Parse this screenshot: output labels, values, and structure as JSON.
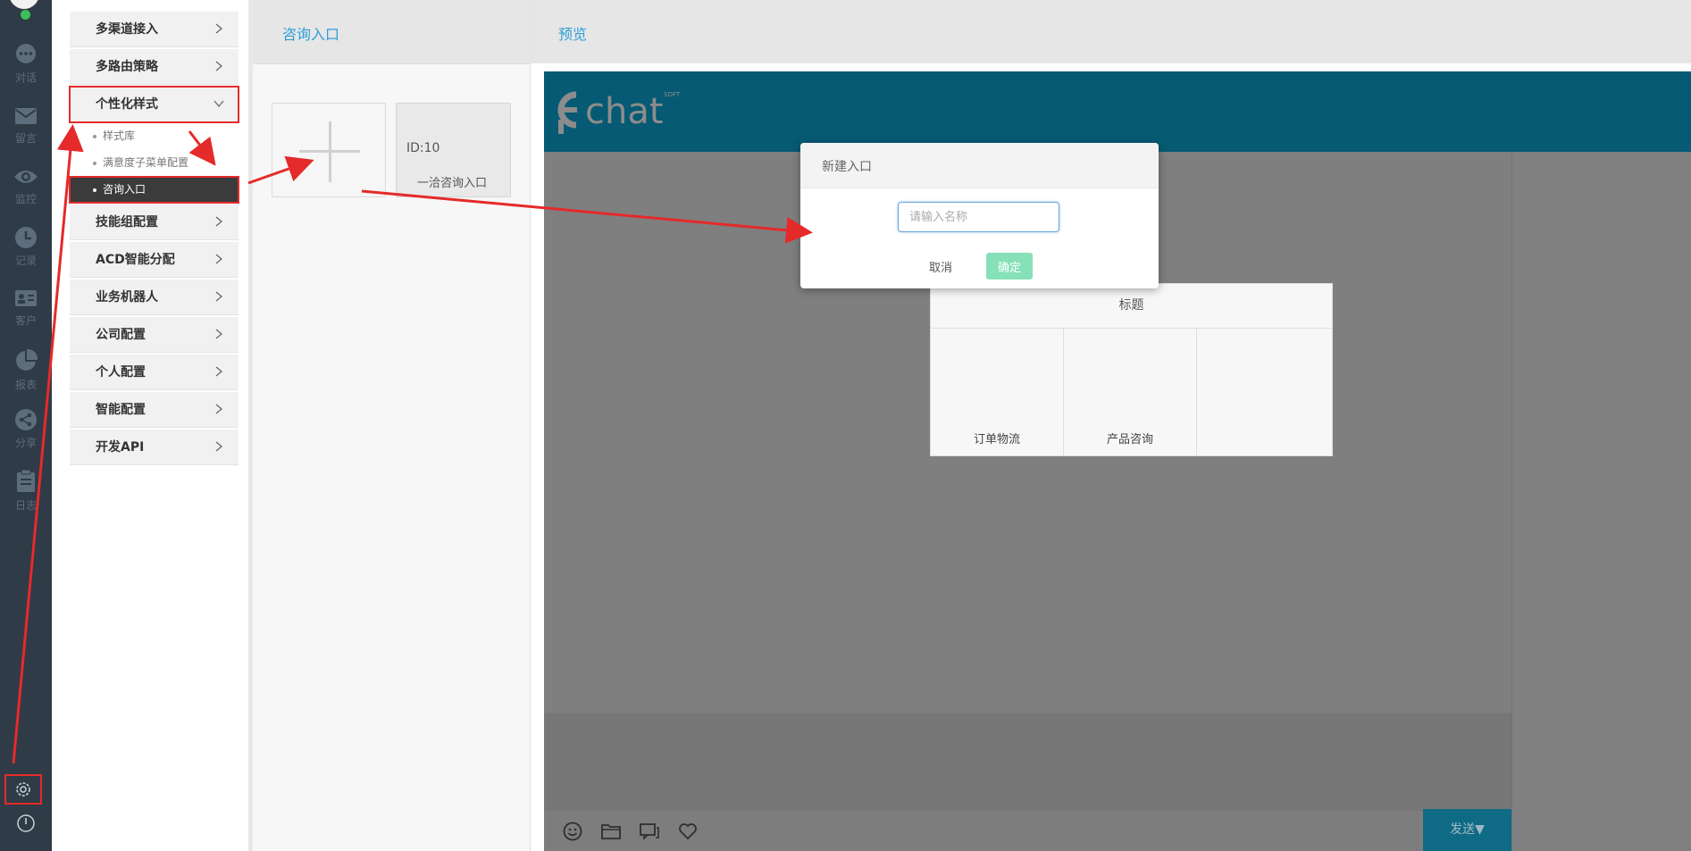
{
  "rail": {
    "items": [
      {
        "label": "对话",
        "icon": "chat-bubble-icon"
      },
      {
        "label": "留言",
        "icon": "envelope-icon"
      },
      {
        "label": "监控",
        "icon": "eye-icon"
      },
      {
        "label": "记录",
        "icon": "clock-icon"
      },
      {
        "label": "客户",
        "icon": "id-card-icon"
      },
      {
        "label": "报表",
        "icon": "pie-chart-icon"
      },
      {
        "label": "分享",
        "icon": "share-icon"
      },
      {
        "label": "日志",
        "icon": "clipboard-icon"
      }
    ],
    "settings_icon": "gear-icon",
    "power_icon": "power-icon"
  },
  "menu": {
    "items": [
      {
        "label": "多渠道接入"
      },
      {
        "label": "多路由策略"
      },
      {
        "label": "个性化样式"
      },
      {
        "label": "技能组配置"
      },
      {
        "label": "ACD智能分配"
      },
      {
        "label": "业务机器人"
      },
      {
        "label": "公司配置"
      },
      {
        "label": "个人配置"
      },
      {
        "label": "智能配置"
      },
      {
        "label": "开发API"
      }
    ],
    "sub_items": [
      {
        "label": "样式库"
      },
      {
        "label": "满意度子菜单配置"
      },
      {
        "label": "咨询入口"
      }
    ]
  },
  "entry": {
    "header": "咨询入口",
    "card_id": "ID:10",
    "card_name": "一洽咨询入口"
  },
  "preview": {
    "header": "预览",
    "logo_text": "chat",
    "logo_small": "SOFT",
    "menu_title": "标题",
    "menu_cells": [
      "订单物流",
      "产品咨询",
      ""
    ],
    "send_label": "发送▼",
    "tools": [
      "smiley-icon",
      "folder-icon",
      "chat-window-icon",
      "heart-icon"
    ]
  },
  "modal": {
    "title": "新建入口",
    "input_placeholder": "请输入名称",
    "cancel_label": "取消",
    "ok_label": "确定"
  },
  "colors": {
    "rail_bg": "#2f3b46",
    "accent_blue": "#2d9fd8",
    "chat_topbar": "#065a73",
    "annotation_red": "#e52a2a",
    "ok_green": "#86e1b8"
  }
}
